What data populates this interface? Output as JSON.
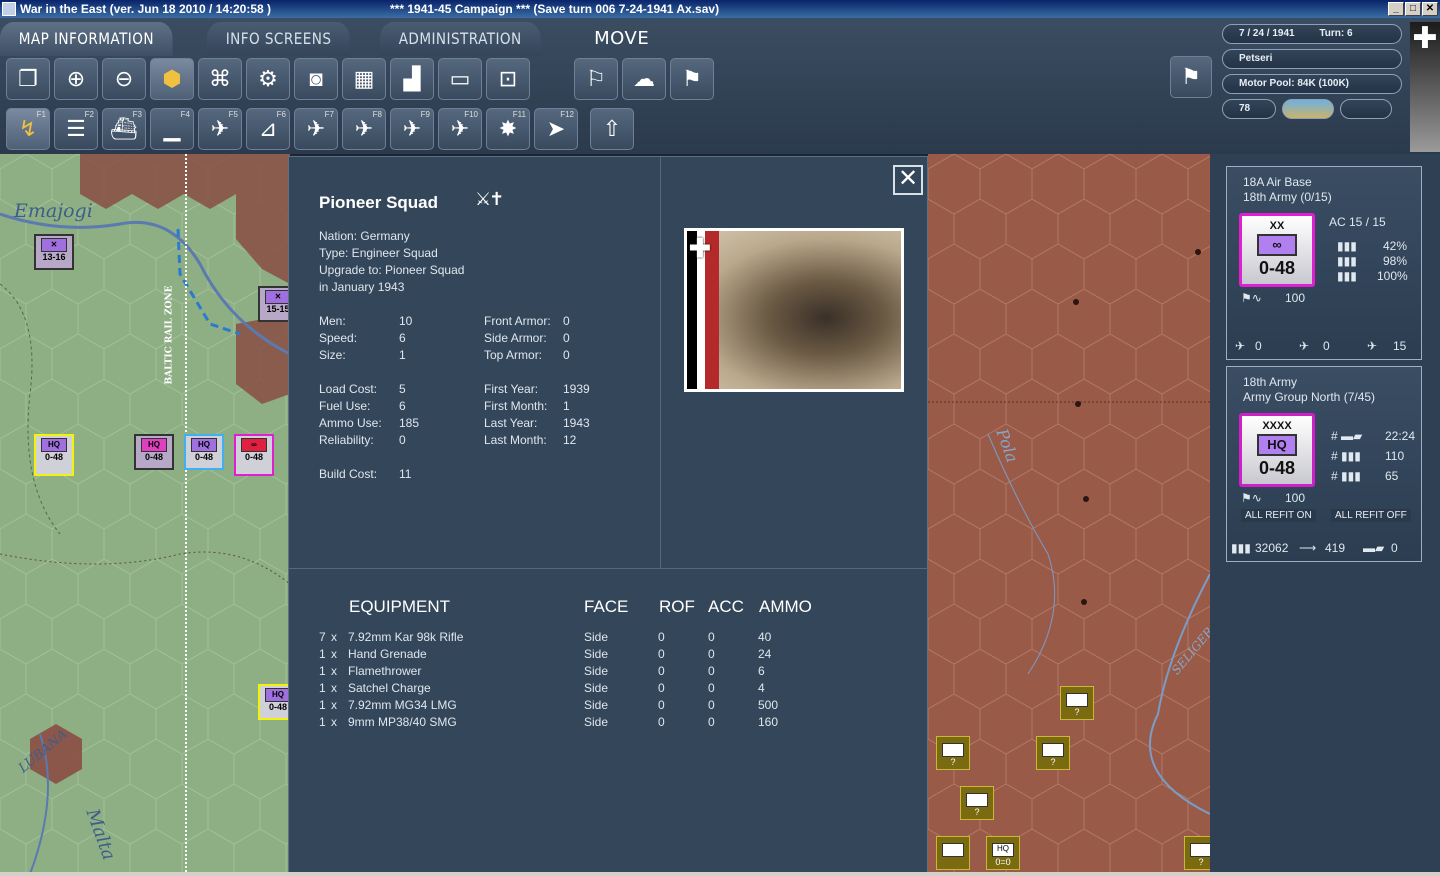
{
  "window": {
    "title_left": "War in the East (ver. Jun 18 2010 / 14:20:58 )",
    "title_mid": "***   1941-45 Campaign   ***   (Save turn 006 7-24-1941 Ax.sav)"
  },
  "tabs": [
    {
      "label": "MAP INFORMATION"
    },
    {
      "label": "INFO SCREENS"
    },
    {
      "label": "ADMINISTRATION"
    },
    {
      "label": "MOVE"
    }
  ],
  "function_keys": [
    "F1",
    "F2",
    "F3",
    "F4",
    "F5",
    "F6",
    "F7",
    "F8",
    "F9",
    "F10",
    "F11",
    "F12"
  ],
  "status": {
    "date": "7 / 24 / 1941",
    "turn": "Turn: 6",
    "location": "Petseri",
    "motor_pool": "Motor Pool:  84K (100K)",
    "value_78": "78"
  },
  "map_labels": {
    "emajogi": "Emajogi",
    "baltic_rail": "BALTIC RAIL ZONE",
    "pola": "Pola",
    "lubana": "LUBANA",
    "malta": "Malta",
    "seliger": "SELIGER"
  },
  "map_units": [
    {
      "label": "13-16"
    },
    {
      "label": "15-15"
    },
    {
      "label": "0-48"
    },
    {
      "label": "0-48"
    },
    {
      "label": "0-48"
    },
    {
      "label": "0-48"
    },
    {
      "label": "0-48"
    },
    {
      "label": "0=0"
    }
  ],
  "dialog": {
    "unit_name": "Pioneer Squad",
    "nation": "Nation: Germany",
    "type": "Type: Engineer Squad",
    "upgrade": "Upgrade to: Pioneer Squad",
    "upgrade_date": "in January 1943",
    "stats_left": [
      {
        "label": "Men:",
        "value": "10"
      },
      {
        "label": "Speed:",
        "value": "6"
      },
      {
        "label": "Size:",
        "value": "1"
      }
    ],
    "armor": [
      {
        "label": "Front Armor:",
        "value": "0"
      },
      {
        "label": "Side Armor:",
        "value": "0"
      },
      {
        "label": "Top Armor:",
        "value": "0"
      }
    ],
    "costs": [
      {
        "label": "Load Cost:",
        "value": "5"
      },
      {
        "label": "Fuel Use:",
        "value": "6"
      },
      {
        "label": "Ammo Use:",
        "value": "185"
      },
      {
        "label": "Reliability:",
        "value": "0"
      }
    ],
    "dates": [
      {
        "label": "First Year:",
        "value": "1939"
      },
      {
        "label": "First Month:",
        "value": "1"
      },
      {
        "label": "Last Year:",
        "value": "1943"
      },
      {
        "label": "Last Month:",
        "value": "12"
      }
    ],
    "build_cost_label": "Build Cost:",
    "build_cost": "11",
    "equipment_header": {
      "equipment": "EQUIPMENT",
      "face": "FACE",
      "rof": "ROF",
      "acc": "ACC",
      "ammo": "AMMO"
    },
    "equipment": [
      {
        "qty": "7",
        "x": "x",
        "name": "7.92mm Kar 98k Rifle",
        "face": "Side",
        "rof": "0",
        "acc": "0",
        "ammo": "40"
      },
      {
        "qty": "1",
        "x": "x",
        "name": "Hand Grenade",
        "face": "Side",
        "rof": "0",
        "acc": "0",
        "ammo": "24"
      },
      {
        "qty": "1",
        "x": "x",
        "name": "Flamethrower",
        "face": "Side",
        "rof": "0",
        "acc": "0",
        "ammo": "6"
      },
      {
        "qty": "1",
        "x": "x",
        "name": "Satchel Charge",
        "face": "Side",
        "rof": "0",
        "acc": "0",
        "ammo": "4"
      },
      {
        "qty": "1",
        "x": "x",
        "name": "7.92mm MG34 LMG",
        "face": "Side",
        "rof": "0",
        "acc": "0",
        "ammo": "500"
      },
      {
        "qty": "1",
        "x": "x",
        "name": "9mm MP38/40 SMG",
        "face": "Side",
        "rof": "0",
        "acc": "0",
        "ammo": "160"
      }
    ]
  },
  "side": {
    "airbase": {
      "title1": "18A Air Base",
      "title2": "18th Army (0/15)",
      "chit_sym": "XX",
      "chit_val": "0-48",
      "ac": "AC  15 / 15",
      "pct1": "42%",
      "pct2": "98%",
      "pct3": "100%",
      "morale": "100",
      "air1": "0",
      "air2": "0",
      "air3": "15"
    },
    "army": {
      "title1": "18th Army",
      "title2": "Army Group North  (7/45)",
      "chit_sym": "XXXX",
      "chit_box": "HQ",
      "chit_val": "0-48",
      "r1_hash": "#",
      "r1": "22:24",
      "r2_hash": "#",
      "r2": "110",
      "r3_hash": "#",
      "r3": "65",
      "morale": "100",
      "refit_on": "ALL REFIT ON",
      "refit_off": "ALL REFIT OFF",
      "men": "32062",
      "guns": "419",
      "afv": "0"
    }
  },
  "colors": {
    "panel": "#34475a",
    "map_green": "#8eae84",
    "map_red": "#9a5a48",
    "title_blue": "#0a246a"
  }
}
